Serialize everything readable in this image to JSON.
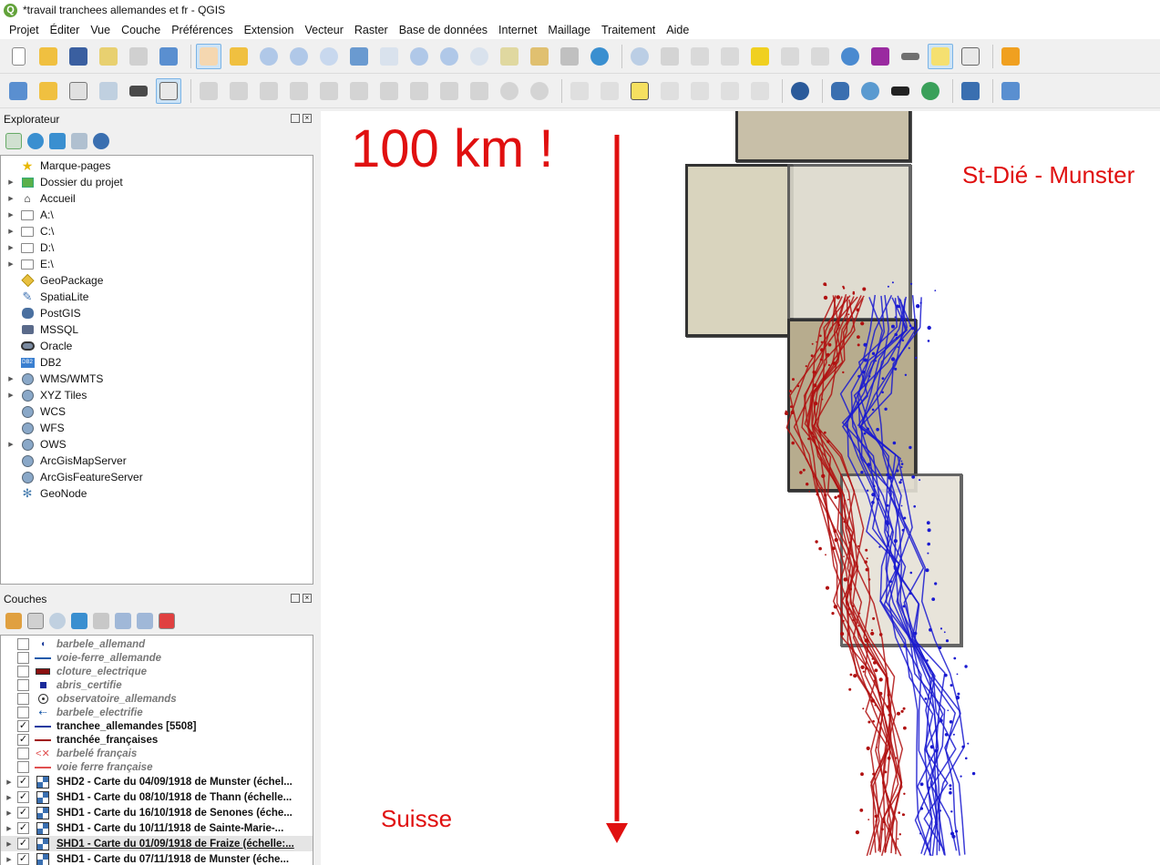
{
  "window": {
    "title": "*travail tranchees allemandes et fr - QGIS",
    "app_icon_letter": "Q"
  },
  "menu": [
    "Projet",
    "Éditer",
    "Vue",
    "Couche",
    "Préférences",
    "Extension",
    "Vecteur",
    "Raster",
    "Base de données",
    "Internet",
    "Maillage",
    "Traitement",
    "Aide"
  ],
  "explorer": {
    "title": "Explorateur",
    "items": [
      {
        "label": "Marque-pages",
        "expand": false,
        "icon": "star-icon"
      },
      {
        "label": "Dossier du projet",
        "expand": true,
        "icon": "project-folder-icon"
      },
      {
        "label": "Accueil",
        "expand": true,
        "icon": "home-icon"
      },
      {
        "label": "A:\\",
        "expand": true,
        "icon": "folder-icon"
      },
      {
        "label": "C:\\",
        "expand": true,
        "icon": "folder-icon"
      },
      {
        "label": "D:\\",
        "expand": true,
        "icon": "folder-icon"
      },
      {
        "label": "E:\\",
        "expand": true,
        "icon": "folder-icon"
      },
      {
        "label": "GeoPackage",
        "expand": false,
        "icon": "geopackage-icon"
      },
      {
        "label": "SpatiaLite",
        "expand": false,
        "icon": "feather-icon"
      },
      {
        "label": "PostGIS",
        "expand": false,
        "icon": "elephant-icon"
      },
      {
        "label": "MSSQL",
        "expand": false,
        "icon": "mssql-icon"
      },
      {
        "label": "Oracle",
        "expand": false,
        "icon": "oracle-icon"
      },
      {
        "label": "DB2",
        "expand": false,
        "icon": "db2-icon"
      },
      {
        "label": "WMS/WMTS",
        "expand": true,
        "icon": "globe-icon"
      },
      {
        "label": "XYZ Tiles",
        "expand": true,
        "icon": "globe-icon"
      },
      {
        "label": "WCS",
        "expand": false,
        "icon": "globe-icon"
      },
      {
        "label": "WFS",
        "expand": false,
        "icon": "globe-icon"
      },
      {
        "label": "OWS",
        "expand": true,
        "icon": "globe-icon"
      },
      {
        "label": "ArcGisMapServer",
        "expand": false,
        "icon": "globe-icon"
      },
      {
        "label": "ArcGisFeatureServer",
        "expand": false,
        "icon": "globe-icon"
      },
      {
        "label": "GeoNode",
        "expand": false,
        "icon": "geonode-icon"
      }
    ]
  },
  "layers": {
    "title": "Couches",
    "items": [
      {
        "label": "barbele_allemand",
        "checked": false,
        "kind": "vector",
        "symbol": "dot-icon",
        "color": "#1a3a9a"
      },
      {
        "label": "voie-ferre_allemande",
        "checked": false,
        "kind": "vector",
        "symbol": "rail-icon",
        "color": "#1a5aaa"
      },
      {
        "label": "cloture_electrique",
        "checked": false,
        "kind": "vector",
        "symbol": "fence-icon",
        "color": "#8a1010"
      },
      {
        "label": "abris_certifie",
        "checked": false,
        "kind": "vector",
        "symbol": "square-icon",
        "color": "#1a2a9a"
      },
      {
        "label": "observatoire_allemands",
        "checked": false,
        "kind": "vector",
        "symbol": "target-icon",
        "color": "#333333"
      },
      {
        "label": "barbele_electrifie",
        "checked": false,
        "kind": "vector",
        "symbol": "arrow-line-icon",
        "color": "#1a5aaa"
      },
      {
        "label": "tranchee_allemandes [5508]",
        "checked": true,
        "kind": "vector",
        "symbol": "line-icon",
        "color": "#1a3aa0"
      },
      {
        "label": "tranchée_françaises",
        "checked": true,
        "kind": "vector",
        "symbol": "line-icon",
        "color": "#a01010"
      },
      {
        "label": "barbelé français",
        "checked": false,
        "kind": "vector",
        "symbol": "cross-line-icon",
        "color": "#e05050"
      },
      {
        "label": "voie ferre française",
        "checked": false,
        "kind": "vector",
        "symbol": "rail-icon",
        "color": "#e05050"
      },
      {
        "label": "SHD2 - Carte du 04/09/1918 de Munster (échel...",
        "checked": true,
        "kind": "raster",
        "symbol": "raster-icon",
        "color": "#222222"
      },
      {
        "label": "SHD1 - Carte du 08/10/1918 de Thann (échelle...",
        "checked": true,
        "kind": "raster",
        "symbol": "raster-icon",
        "color": "#222222"
      },
      {
        "label": "SHD1 - Carte du 16/10/1918 de Senones (éche...",
        "checked": true,
        "kind": "raster",
        "symbol": "raster-icon",
        "color": "#222222"
      },
      {
        "label": "SHD1 - Carte du 10/11/1918 de Sainte-Marie-...",
        "checked": true,
        "kind": "raster",
        "symbol": "raster-icon",
        "color": "#222222"
      },
      {
        "label": "SHD1 - Carte du 01/09/1918 de Fraize (échelle:...",
        "checked": true,
        "kind": "raster",
        "symbol": "raster-icon",
        "color": "#222222",
        "selected": true
      },
      {
        "label": "SHD1 - Carte du 07/11/1918 de Munster (éche...",
        "checked": true,
        "kind": "raster",
        "symbol": "raster-icon",
        "color": "#222222"
      }
    ]
  },
  "map": {
    "annotation_distance": "100 km !",
    "label_north": "St-Dié - Munster",
    "label_south": "Suisse",
    "annotation_color": "#e01010",
    "trench_german_color": "#1a1ad0",
    "trench_french_color": "#b01010"
  },
  "colors": {
    "accent": "#62a23a",
    "selection": "#cde4f7"
  }
}
